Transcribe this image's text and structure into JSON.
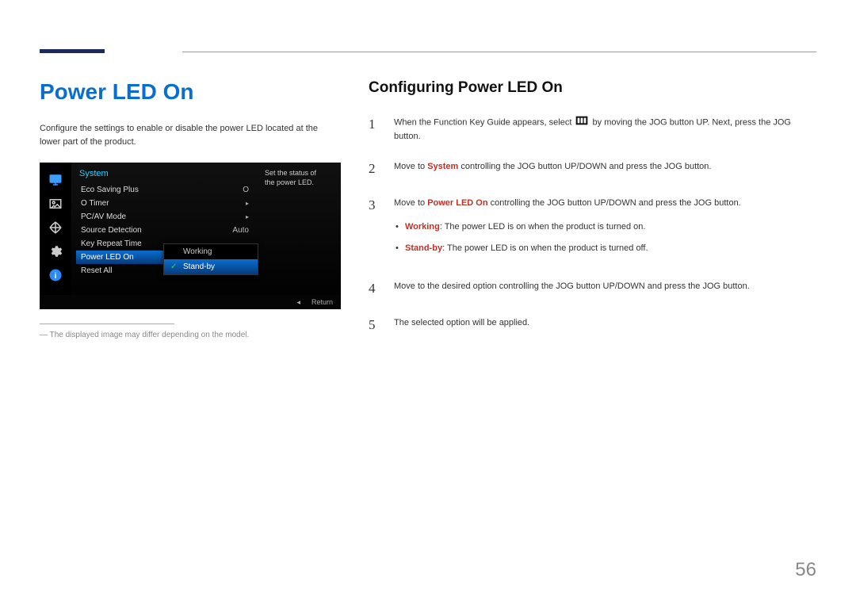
{
  "page_number": "56",
  "left": {
    "title": "Power LED On",
    "intro": "Configure the settings to enable or disable the power LED located at the lower part of the product.",
    "footnote": "The displayed image may differ depending on the model."
  },
  "osd": {
    "menu_title": "System",
    "help_text": "Set the status of the power LED.",
    "rows": [
      {
        "label": "Eco Saving Plus",
        "value": "O",
        "chevron": false
      },
      {
        "label": "O  Timer",
        "value": "",
        "chevron": true
      },
      {
        "label": "PC/AV Mode",
        "value": "",
        "chevron": true
      },
      {
        "label": "Source Detection",
        "value": "Auto",
        "chevron": false
      },
      {
        "label": "Key Repeat Time",
        "value": "",
        "chevron": false
      },
      {
        "label": "Power LED On",
        "value": "",
        "chevron": false,
        "selected": true
      },
      {
        "label": "Reset All",
        "value": "",
        "chevron": false
      }
    ],
    "submenu": [
      {
        "label": "Working",
        "selected": false
      },
      {
        "label": "Stand-by",
        "selected": true
      }
    ],
    "footer_nav": "◂",
    "footer_return": "Return",
    "icons": [
      "monitor-icon",
      "picture-icon",
      "arrows-icon",
      "gear-icon",
      "info-icon"
    ]
  },
  "right": {
    "heading": "Configuring Power LED On",
    "steps": [
      {
        "num": "1",
        "pre": "When the Function Key Guide appears, select ",
        "post": " by moving the JOG button UP. Next, press the JOG button."
      },
      {
        "num": "2",
        "pre": "Move to ",
        "bold": "System",
        "post": " controlling the JOG button UP/DOWN and press the JOG button."
      },
      {
        "num": "3",
        "pre": "Move to ",
        "bold": "Power LED On",
        "post": " controlling the JOG button UP/DOWN and press the JOG button.",
        "bullets": [
          {
            "bold": "Working",
            "text": ": The power LED is on when the product is turned on."
          },
          {
            "bold": "Stand-by",
            "text": ": The power LED is on when the product is turned off."
          }
        ]
      },
      {
        "num": "4",
        "text": "Move to the desired option controlling the JOG button UP/DOWN and press the JOG button."
      },
      {
        "num": "5",
        "text": "The selected option will be applied."
      }
    ]
  }
}
